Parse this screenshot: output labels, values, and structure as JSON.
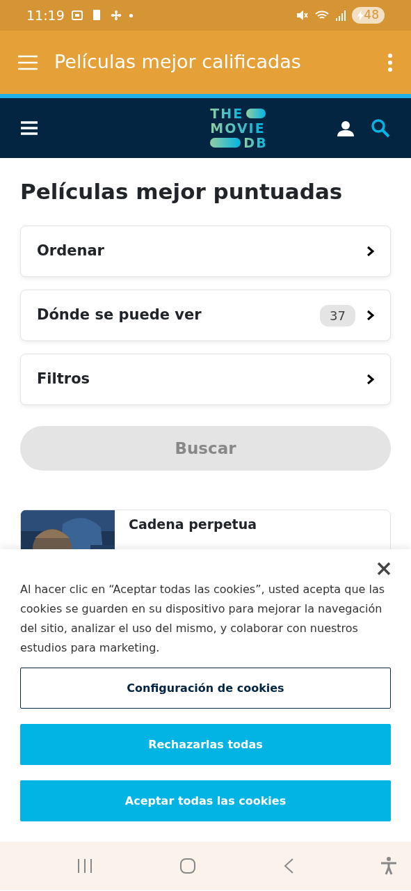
{
  "status_bar": {
    "time": "11:19",
    "battery": "48"
  },
  "app_bar": {
    "title": "Películas mejor calificadas"
  },
  "site_nav": {
    "logo": [
      "THE",
      "MOVIE",
      "DB"
    ]
  },
  "page_title": "Películas mejor puntuadas",
  "panels": [
    {
      "label": "Ordenar"
    },
    {
      "label": "Dónde se puede ver",
      "count": "37"
    },
    {
      "label": "Filtros"
    }
  ],
  "search_button": {
    "label": "Buscar",
    "disabled": true
  },
  "movies": [
    {
      "title": "Cadena perpetua",
      "kind": "picture"
    }
  ],
  "cookie_banner": {
    "text": "Al hacer clic en “Aceptar todas las cookies”, usted acepta que las cookies se guarden en su dispositivo para mejorar la navegación del sitio, analizar el uso del mismo, y colaborar con nuestros estudios para marketing.",
    "buttons": [
      {
        "label": "Configuración de cookies",
        "kind": "outline"
      },
      {
        "label": "Rechazarlas todas",
        "kind": "filled"
      },
      {
        "label": "Aceptar todas las cookies",
        "kind": "filled"
      }
    ]
  }
}
